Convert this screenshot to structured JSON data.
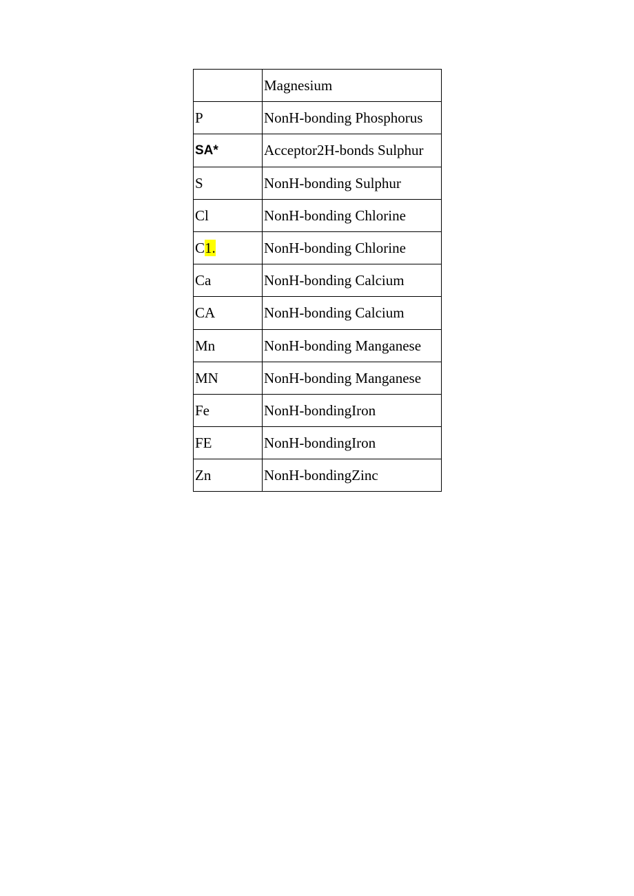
{
  "rows": [
    {
      "code": "",
      "code_class": "",
      "prehl": "",
      "hl": "",
      "desc": "Magnesium"
    },
    {
      "code": "P",
      "code_class": "",
      "prehl": "P",
      "hl": "",
      "desc": "NonH-bonding Phosphorus"
    },
    {
      "code": "SA*",
      "code_class": "bold-sans",
      "prehl": "SA*",
      "hl": "",
      "desc": "Acceptor2H-bonds Sulphur"
    },
    {
      "code": "S",
      "code_class": "",
      "prehl": "S",
      "hl": "",
      "desc": "NonH-bonding Sulphur"
    },
    {
      "code": "Cl",
      "code_class": "",
      "prehl": "Cl",
      "hl": "",
      "desc": "NonH-bonding Chlorine"
    },
    {
      "code": "C1.",
      "code_class": "",
      "prehl": "C",
      "hl": "1.",
      "desc": "NonH-bonding Chlorine"
    },
    {
      "code": "Ca",
      "code_class": "",
      "prehl": "Ca",
      "hl": "",
      "desc": "NonH-bonding Calcium"
    },
    {
      "code": "CA",
      "code_class": "",
      "prehl": "CA",
      "hl": "",
      "desc": "NonH-bonding Calcium"
    },
    {
      "code": "Mn",
      "code_class": "",
      "prehl": "Mn",
      "hl": "",
      "desc": "NonH-bonding Manganese"
    },
    {
      "code": "MN",
      "code_class": "",
      "prehl": "MN",
      "hl": "",
      "desc": "NonH-bonding Manganese"
    },
    {
      "code": "Fe",
      "code_class": "",
      "prehl": "Fe",
      "hl": "",
      "desc": "NonH-bondingIron"
    },
    {
      "code": "FE",
      "code_class": "",
      "prehl": "FE",
      "hl": "",
      "desc": "NonH-bondingIron"
    },
    {
      "code": "Zn",
      "code_class": "",
      "prehl": "Zn",
      "hl": "",
      "desc": "NonH-bondingZinc"
    }
  ]
}
